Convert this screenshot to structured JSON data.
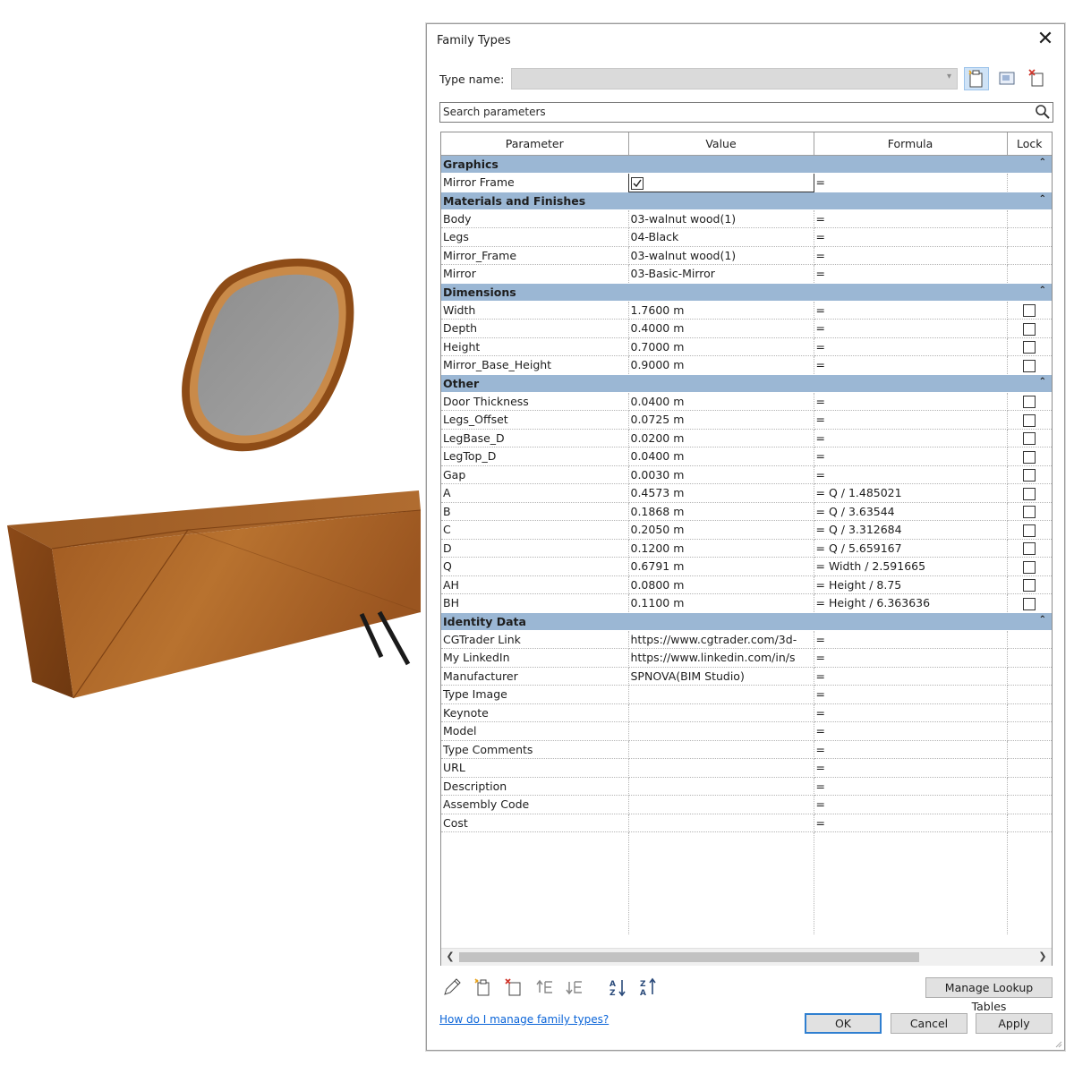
{
  "dialog": {
    "title": "Family Types",
    "type_name_label": "Type name:",
    "type_name_value": "",
    "search_placeholder": "Search parameters",
    "columns": [
      "Parameter",
      "Value",
      "Formula",
      "Lock"
    ],
    "groups": [
      {
        "name": "Graphics",
        "rows": [
          {
            "parameter": "Mirror Frame",
            "value": "",
            "value_checkbox": true,
            "value_checked": true,
            "formula": "=",
            "lock": null
          }
        ]
      },
      {
        "name": "Materials and Finishes",
        "rows": [
          {
            "parameter": "Body",
            "value": "03-walnut wood(1)",
            "formula": "=",
            "lock": null
          },
          {
            "parameter": "Legs",
            "value": "04-Black",
            "formula": "=",
            "lock": null
          },
          {
            "parameter": "Mirror_Frame",
            "value": "03-walnut wood(1)",
            "formula": "=",
            "lock": null
          },
          {
            "parameter": "Mirror",
            "value": "03-Basic-Mirror",
            "formula": "=",
            "lock": null
          }
        ]
      },
      {
        "name": "Dimensions",
        "rows": [
          {
            "parameter": "Width",
            "value": "1.7600 m",
            "formula": "=",
            "lock": false
          },
          {
            "parameter": "Depth",
            "value": "0.4000 m",
            "formula": "=",
            "lock": false
          },
          {
            "parameter": "Height",
            "value": "0.7000 m",
            "formula": "=",
            "lock": false
          },
          {
            "parameter": "Mirror_Base_Height",
            "value": "0.9000 m",
            "formula": "=",
            "lock": false
          }
        ]
      },
      {
        "name": "Other",
        "rows": [
          {
            "parameter": "Door Thickness",
            "value": "0.0400 m",
            "formula": "=",
            "lock": false
          },
          {
            "parameter": "Legs_Offset",
            "value": "0.0725 m",
            "formula": "=",
            "lock": false
          },
          {
            "parameter": "LegBase_D",
            "value": "0.0200 m",
            "formula": "=",
            "lock": false
          },
          {
            "parameter": "LegTop_D",
            "value": "0.0400 m",
            "formula": "=",
            "lock": false
          },
          {
            "parameter": "Gap",
            "value": "0.0030 m",
            "formula": "=",
            "lock": false
          },
          {
            "parameter": "A",
            "value": "0.4573 m",
            "formula": "= Q / 1.485021",
            "lock": false
          },
          {
            "parameter": "B",
            "value": "0.1868 m",
            "formula": "= Q / 3.63544",
            "lock": false
          },
          {
            "parameter": "C",
            "value": "0.2050 m",
            "formula": "= Q / 3.312684",
            "lock": false
          },
          {
            "parameter": "D",
            "value": "0.1200 m",
            "formula": "= Q / 5.659167",
            "lock": false
          },
          {
            "parameter": "Q",
            "value": "0.6791 m",
            "formula": "= Width / 2.591665",
            "lock": false
          },
          {
            "parameter": "AH",
            "value": "0.0800 m",
            "formula": "= Height / 8.75",
            "lock": false
          },
          {
            "parameter": "BH",
            "value": "0.1100 m",
            "formula": "= Height / 6.363636",
            "lock": false
          }
        ]
      },
      {
        "name": "Identity Data",
        "rows": [
          {
            "parameter": "CGTrader Link",
            "value": "https://www.cgtrader.com/3d-",
            "formula": "=",
            "lock": null
          },
          {
            "parameter": "My LinkedIn",
            "value": "https://www.linkedin.com/in/s",
            "formula": "=",
            "lock": null
          },
          {
            "parameter": "Manufacturer",
            "value": "SPNOVA(BIM Studio)",
            "formula": "=",
            "lock": null
          },
          {
            "parameter": "Type Image",
            "value": "",
            "formula": "=",
            "lock": null
          },
          {
            "parameter": "Keynote",
            "value": "",
            "formula": "=",
            "lock": null
          },
          {
            "parameter": "Model",
            "value": "",
            "formula": "=",
            "lock": null
          },
          {
            "parameter": "Type Comments",
            "value": "",
            "formula": "=",
            "lock": null
          },
          {
            "parameter": "URL",
            "value": "",
            "formula": "=",
            "lock": null
          },
          {
            "parameter": "Description",
            "value": "",
            "formula": "=",
            "lock": null
          },
          {
            "parameter": "Assembly Code",
            "value": "",
            "formula": "=",
            "lock": null
          },
          {
            "parameter": "Cost",
            "value": "",
            "formula": "=",
            "lock": null
          }
        ]
      }
    ],
    "buttons": {
      "manage_lookup": "Manage Lookup Tables",
      "ok": "OK",
      "cancel": "Cancel",
      "apply": "Apply"
    },
    "help_link": "How do I manage family types?",
    "icons": {
      "toolbar": [
        "new-type-icon",
        "rename-type-icon",
        "delete-type-icon"
      ],
      "bottom": [
        "edit-parameter-icon",
        "new-parameter-icon",
        "delete-parameter-icon",
        "move-up-icon",
        "move-down-icon",
        "sort-ascending-icon",
        "sort-descending-icon"
      ]
    }
  },
  "colors": {
    "group_header": "#9bb7d4",
    "accent": "#2f7fd0",
    "link": "#0a64d8",
    "wood": "#a8642b"
  }
}
